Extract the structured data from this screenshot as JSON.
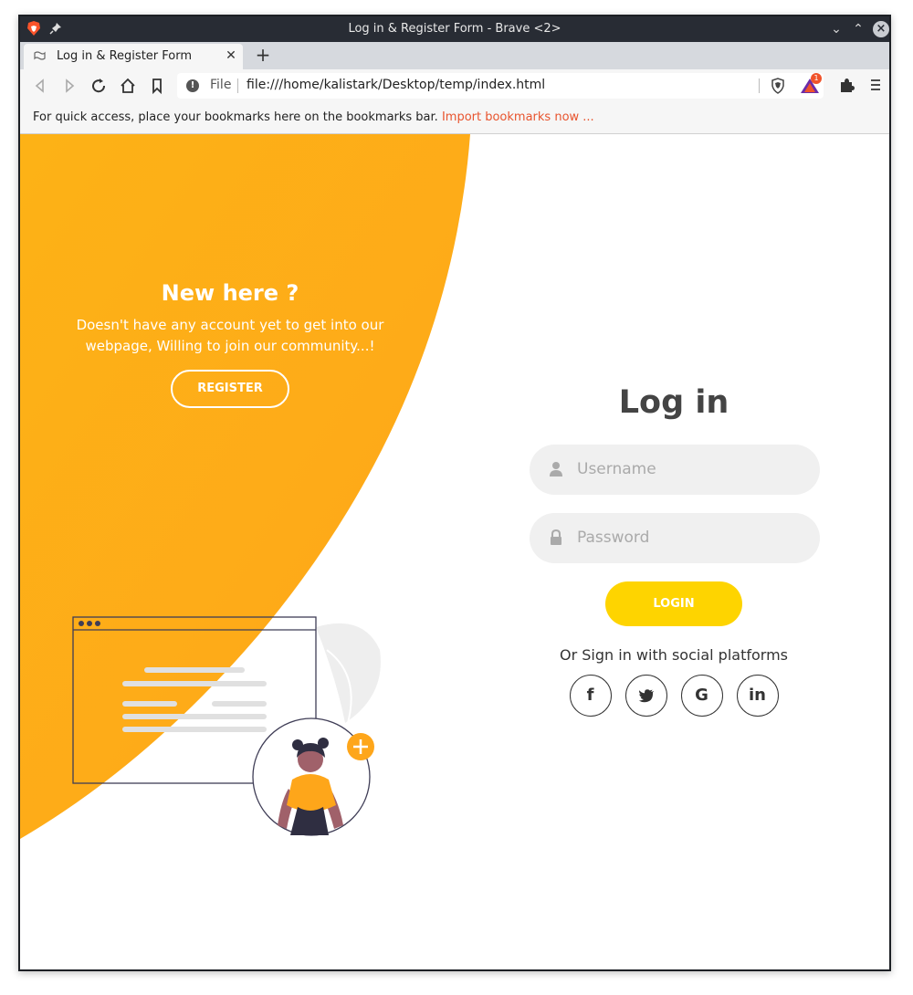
{
  "window": {
    "title": "Log in & Register Form - Brave <2>"
  },
  "tab": {
    "label": "Log in & Register Form",
    "close": "✕",
    "new": "+"
  },
  "urlbar": {
    "scheme": "File",
    "url": "file:///home/kalistark/Desktop/temp/index.html",
    "rewards_badge": "1"
  },
  "bookmarks": {
    "message": "For quick access, place your bookmarks here on the bookmarks bar. ",
    "import_link": "Import bookmarks now ..."
  },
  "left_panel": {
    "heading": "New here ?",
    "text": "Doesn't have any account yet to get into our webpage, Willing to join our community...!",
    "button": "REGISTER"
  },
  "login_form": {
    "title": "Log in",
    "username_placeholder": "Username",
    "password_placeholder": "Password",
    "button": "LOGIN",
    "social_text": "Or Sign in with social platforms",
    "social": [
      "f",
      "t",
      "G",
      "in"
    ]
  },
  "colors": {
    "accent_orange": "#fea61a",
    "login_yellow": "#fed400",
    "field_bg": "#f0f0f0",
    "brave_orange": "#fb542b"
  }
}
